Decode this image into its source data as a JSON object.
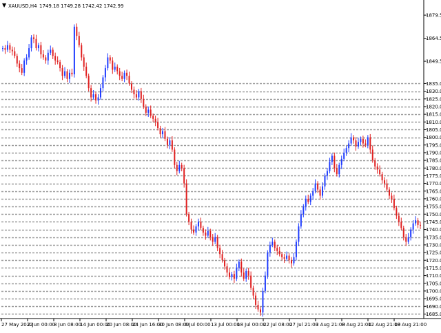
{
  "header": {
    "symbol_label": "XAUUSD,H4",
    "ohlc_text": "1749.18 1749.28 1742.42 1742.99"
  },
  "colors": {
    "background": "#ffffff",
    "axis": "#000000",
    "bull": "#1f3cff",
    "bear": "#e02020",
    "grid_level": "#9a9a9a"
  },
  "chart_data": {
    "type": "line",
    "title": "",
    "symbol": "XAUUSD",
    "timeframe": "H4",
    "xlabel": "",
    "ylabel": "",
    "ylim": [
      1682.5,
      1884.0
    ],
    "grid": true,
    "x_ticks": [
      "27 May 2022",
      "2 Jun 00:00",
      "8 Jun 08:00",
      "14 Jun 00:00",
      "20 Jun 08:00",
      "24 Jun 16:00",
      "30 Jun 08:00",
      "6 Jul 00:00",
      "13 Jul 00:00",
      "18 Jul 00:00",
      "22 Jul 08:00",
      "27 Jul 21:00",
      "3 Aug 21:00",
      "8 Aug 21:00",
      "12 Aug 21:00",
      "18 Aug 21:00"
    ],
    "y_ticks": [
      1879.5,
      1864.5,
      1849.5,
      1835.0,
      1830.0,
      1825.0,
      1820.0,
      1815.0,
      1810.0,
      1805.0,
      1800.0,
      1795.0,
      1790.0,
      1785.0,
      1780.0,
      1775.0,
      1770.0,
      1765.0,
      1760.0,
      1755.0,
      1750.0,
      1745.0,
      1740.0,
      1735.0,
      1730.0,
      1725.0,
      1720.0,
      1715.0,
      1710.0,
      1705.0,
      1700.0,
      1695.0,
      1690.0,
      1685.0
    ],
    "levels_from": 1685.0,
    "levels_to": 1835.0,
    "levels_step": 5.0,
    "series": [
      {
        "values": [
          1858,
          1857,
          1860,
          1857,
          1856,
          1853,
          1848,
          1845,
          1842,
          1850,
          1852,
          1858,
          1865,
          1864,
          1858,
          1860,
          1854,
          1852,
          1850,
          1855,
          1857,
          1853,
          1850,
          1849,
          1845,
          1840,
          1843,
          1838,
          1842,
          1841,
          1872,
          1866,
          1860,
          1852,
          1846,
          1840,
          1832,
          1826,
          1828,
          1824,
          1826,
          1832,
          1839,
          1845,
          1852,
          1850,
          1844,
          1846,
          1843,
          1840,
          1838,
          1842,
          1840,
          1835,
          1831,
          1828,
          1826,
          1830,
          1825,
          1820,
          1816,
          1818,
          1814,
          1812,
          1810,
          1806,
          1802,
          1804,
          1799,
          1795,
          1798,
          1792,
          1782,
          1778,
          1782,
          1780,
          1770,
          1750,
          1745,
          1740,
          1738,
          1742,
          1745,
          1741,
          1738,
          1736,
          1739,
          1735,
          1732,
          1735,
          1728,
          1724,
          1720,
          1716,
          1712,
          1709,
          1711,
          1708,
          1715,
          1719,
          1712,
          1708,
          1713,
          1710,
          1702,
          1697,
          1691,
          1688,
          1686,
          1700,
          1710,
          1725,
          1730,
          1732,
          1728,
          1726,
          1724,
          1722,
          1721,
          1723,
          1720,
          1718,
          1722,
          1732,
          1742,
          1750,
          1755,
          1760,
          1758,
          1762,
          1765,
          1770,
          1766,
          1762,
          1768,
          1775,
          1778,
          1784,
          1788,
          1780,
          1776,
          1782,
          1786,
          1790,
          1793,
          1796,
          1800,
          1798,
          1794,
          1797,
          1799,
          1796,
          1795,
          1800,
          1792,
          1785,
          1781,
          1779,
          1776,
          1772,
          1770,
          1766,
          1762,
          1760,
          1754,
          1749,
          1745,
          1741,
          1735,
          1732,
          1735,
          1740,
          1744,
          1746,
          1743,
          1742.99
        ]
      }
    ]
  }
}
